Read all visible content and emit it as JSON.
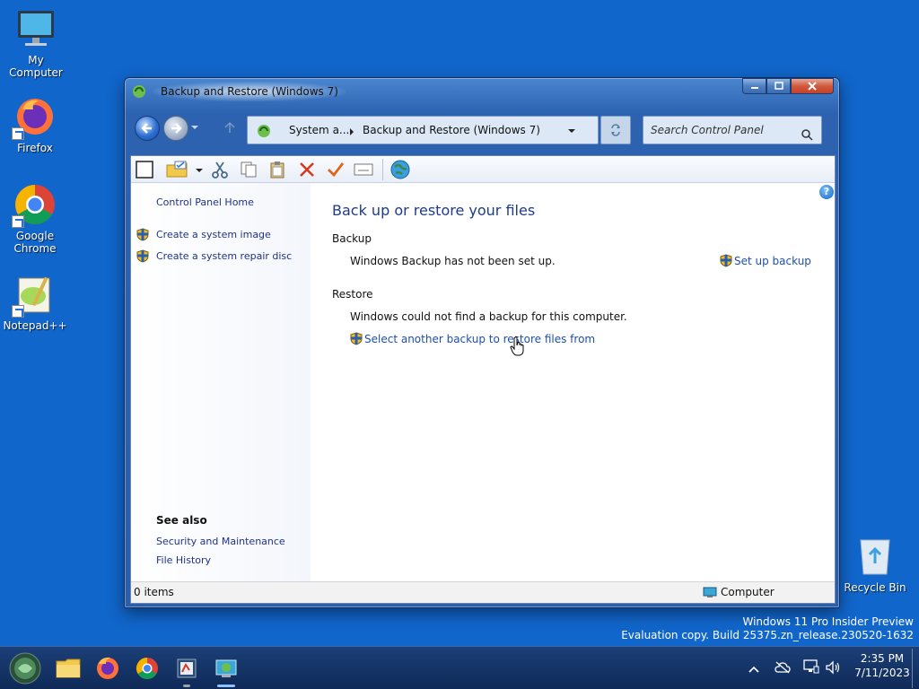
{
  "desktop": {
    "icons": [
      {
        "label": "My Computer",
        "icon": "monitor-icon"
      },
      {
        "label": "Firefox",
        "icon": "firefox-icon"
      },
      {
        "label": "Google Chrome",
        "icon": "chrome-icon"
      },
      {
        "label": "Notepad++",
        "icon": "notepadpp-icon"
      },
      {
        "label": "Recycle Bin",
        "icon": "recycle-bin-icon"
      }
    ],
    "watermark": {
      "line1": "Windows 11 Pro Insider Preview",
      "line2": "Evaluation copy. Build 25375.zn_release.230520-1632"
    }
  },
  "window": {
    "title": "Backup and Restore (Windows 7)",
    "caption": {
      "minimize": "minimize",
      "maximize": "maximize",
      "close": "close"
    },
    "address": {
      "crumbs": [
        "System a...",
        "Backup and Restore (Windows 7)"
      ]
    },
    "search": {
      "placeholder": "Search Control Panel"
    },
    "toolbar": [
      "layout-icon",
      "new-folder-icon",
      "cut-icon",
      "copy-icon",
      "paste-icon",
      "delete-icon",
      "check-icon",
      "email-icon",
      "globe-icon"
    ],
    "sidebar": {
      "home": "Control Panel Home",
      "links": [
        "Create a system image",
        "Create a system repair disc"
      ],
      "see_also_title": "See also",
      "see_also": [
        "Security and Maintenance",
        "File History"
      ]
    },
    "main": {
      "heading": "Back up or restore your files",
      "backup": {
        "title": "Backup",
        "message": "Windows Backup has not been set up.",
        "action": "Set up backup"
      },
      "restore": {
        "title": "Restore",
        "message": "Windows could not find a backup for this computer.",
        "action": "Select another backup to restore files from"
      },
      "help": "?"
    },
    "status": {
      "items": "0 items",
      "location": "Computer"
    }
  },
  "taskbar": {
    "apps": [
      "start-orb",
      "file-explorer",
      "firefox",
      "chrome",
      "control-panel",
      "backup-and-restore"
    ],
    "clock": {
      "time": "2:35 PM",
      "date": "7/11/2023"
    }
  },
  "colors": {
    "desktop": "#1166cc",
    "link": "#1e4fa8",
    "heading": "#1e3b8c"
  }
}
